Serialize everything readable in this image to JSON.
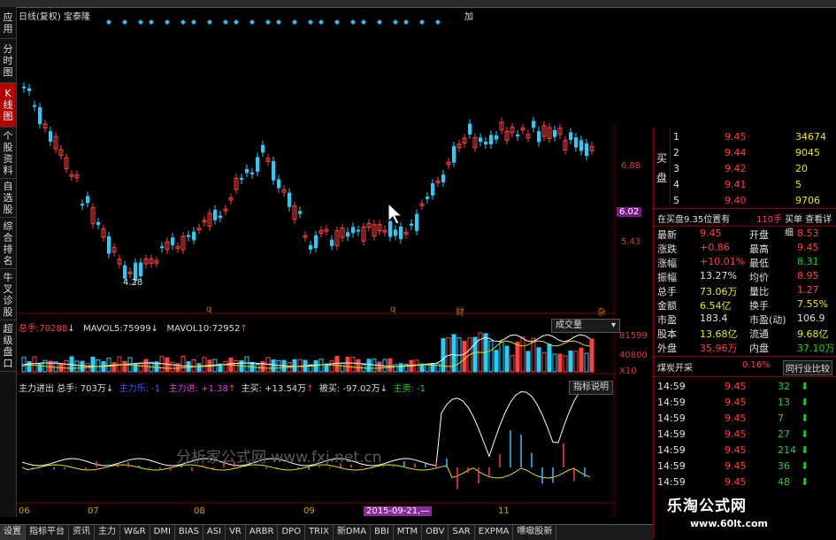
{
  "left_tabs": [
    {
      "label": "应用",
      "chars": [
        "应",
        "用"
      ]
    },
    {
      "label": "分时图",
      "chars": [
        "分",
        "时",
        "图"
      ]
    },
    {
      "label": "K线图",
      "chars": [
        "K",
        "线",
        "图"
      ],
      "active": true
    },
    {
      "label": "个股资料",
      "chars": [
        "个",
        "股",
        "资",
        "料"
      ]
    },
    {
      "label": "自选股",
      "chars": [
        "自",
        "选",
        "股"
      ]
    },
    {
      "label": "综合排名",
      "chars": [
        "综",
        "合",
        "排",
        "名"
      ]
    },
    {
      "label": "牛叉诊股",
      "chars": [
        "牛",
        "叉",
        "诊",
        "股"
      ]
    },
    {
      "label": "超级盘口",
      "chars": [
        "超",
        "级",
        "盘",
        "口"
      ]
    }
  ],
  "chart_header": {
    "title": "日线(复权) 宝泰隆",
    "right_char": "加"
  },
  "main_chart": {
    "y_ticks": [
      "6.88",
      "5.43"
    ],
    "current_price_label": "6.02",
    "low_label": "4.28",
    "markers": [
      "q",
      "q",
      "财",
      "杂"
    ]
  },
  "volume_panel": {
    "total_label": "总手:",
    "total_value": "70288",
    "mavol5_label": "MAVOL5:",
    "mavol5_value": "75999",
    "mavol10_label": "MAVOL10:",
    "mavol10_value": "72952",
    "dropdown": "成交量",
    "y_ticks": [
      "81599",
      "40800"
    ],
    "unit": "X10"
  },
  "flow_panel": {
    "title": "主力进出",
    "total": "总手: 703万",
    "zhuli_le": "主力乐: -1",
    "zhuli_jin": "主力进: +1.38",
    "zhumai": "主买: +13.54万",
    "beimai": "被买: -97.02万",
    "zhumai2": "主卖: -1",
    "button": "指标说明",
    "watermark": "分析家公式网 www.fxj.net.cn"
  },
  "x_axis": {
    "months": [
      "06",
      "07",
      "08",
      "09",
      "11"
    ],
    "date_badge": "2015-09-21,—"
  },
  "bottom_tabs": [
    "设置",
    "指标平台",
    "资讯",
    "主力",
    "W&R",
    "DMI",
    "BIAS",
    "ASI",
    "VR",
    "ARBR",
    "DPO",
    "TRIX",
    "新DMA",
    "BBI",
    "MTM",
    "OBV",
    "SAR",
    "EXPMA",
    "嘌噷股新"
  ],
  "order_book": {
    "side_label_buy": "买",
    "side_label_sell": "盘",
    "rows": [
      {
        "level": "1",
        "price": "9.45",
        "vol": "34674"
      },
      {
        "level": "2",
        "price": "9.44",
        "vol": "9045"
      },
      {
        "level": "3",
        "price": "9.42",
        "vol": "20"
      },
      {
        "level": "4",
        "price": "9.41",
        "vol": "5"
      },
      {
        "level": "5",
        "price": "9.40",
        "vol": "9706"
      }
    ],
    "summary": "在买盘9.35位置有",
    "summary_val": "110手",
    "summary_btn": "买单 查看详细"
  },
  "stats": [
    {
      "l1": "最新",
      "v1": "9.45",
      "c1": "red",
      "l2": "开盘",
      "v2": "8.53",
      "c2": "red"
    },
    {
      "l1": "涨跌",
      "v1": "+0.86",
      "c1": "red",
      "l2": "最高",
      "v2": "9.45",
      "c2": "red"
    },
    {
      "l1": "涨幅",
      "v1": "+10.01%",
      "c1": "red",
      "l2": "最低",
      "v2": "8.31",
      "c2": "green"
    },
    {
      "l1": "振幅",
      "v1": "13.27%",
      "c1": "white",
      "l2": "均价",
      "v2": "8.95",
      "c2": "red"
    },
    {
      "l1": "总手",
      "v1": "73.06万",
      "c1": "yellow",
      "l2": "量比",
      "v2": "1.27",
      "c2": "red"
    },
    {
      "l1": "金额",
      "v1": "6.54亿",
      "c1": "yellow",
      "l2": "换手",
      "v2": "7.55%",
      "c2": "yellow"
    },
    {
      "l1": "市盈",
      "v1": "183.4",
      "c1": "white",
      "l2": "市盈(动)",
      "v2": "106.9",
      "c2": "white"
    },
    {
      "l1": "股本",
      "v1": "13.68亿",
      "c1": "yellow",
      "l2": "流通",
      "v2": "9.68亿",
      "c2": "yellow"
    },
    {
      "l1": "外盘",
      "v1": "35.96万",
      "c1": "red",
      "l2": "内盘",
      "v2": "37.10万",
      "c2": "green"
    }
  ],
  "industry": {
    "name": "煤炭开采",
    "pct": "0.16%",
    "button": "同行业比较"
  },
  "ticks": [
    {
      "time": "14:59",
      "price": "9.45",
      "vol": "32"
    },
    {
      "time": "14:59",
      "price": "9.45",
      "vol": "13"
    },
    {
      "time": "14:59",
      "price": "9.45",
      "vol": "7"
    },
    {
      "time": "14:59",
      "price": "9.45",
      "vol": "27"
    },
    {
      "time": "14:59",
      "price": "9.45",
      "vol": "214"
    },
    {
      "time": "14:59",
      "price": "9.45",
      "vol": "36"
    },
    {
      "time": "14:59",
      "price": "9.45",
      "vol": "48"
    }
  ],
  "site_watermark": {
    "title": "乐淘公式网",
    "url": "www.60lt.com"
  },
  "colors": {
    "up": "#ff4040",
    "down": "#20d0ff",
    "panel_border": "#7a0000"
  }
}
